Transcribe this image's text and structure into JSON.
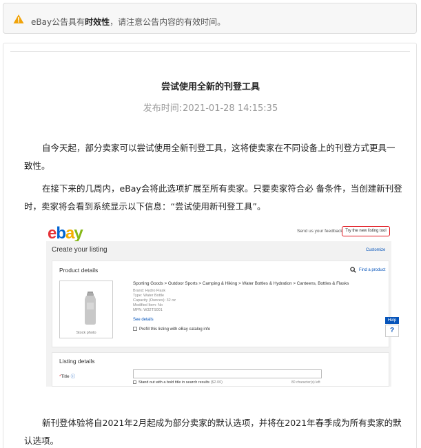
{
  "notice": {
    "prefix": "eBay公告具有",
    "emphasis": "时效性",
    "suffix": "，请注意公告内容的有效时间。"
  },
  "article": {
    "title": "尝试使用全新的刊登工具",
    "publish_label": "发布时间:",
    "publish_time": "2021-01-28 14:15:35",
    "paragraphs": [
      "自今天起，部分卖家可以尝试使用全新刊登工具，这将使卖家在不同设备上的刊登方式更具一致性。",
      "在接下来的几周内，eBay会将此选项扩展至所有卖家。只要卖家符合必 备条件，当创建新刊登时，卖家将会看到系统显示以下信息：“尝试使用新刊登工具”。",
      "新刊登体验将自2021年2月起成为部分卖家的默认选项，并将在2021年春季成为所有卖家的默认选项。"
    ]
  },
  "screenshot": {
    "logo": {
      "e": "e",
      "b": "b",
      "a": "a",
      "y": "y"
    },
    "feedback_link": "Send us your feedback",
    "try_new_tool": "Try the new listing tool",
    "create_title": "Create your listing",
    "customize": "Customize",
    "product_details_title": "Product details",
    "find_product": "Find a product",
    "stock_photo": "Stock photo",
    "categories": "Sporting Goods > Outdoor Sports > Camping & Hiking > Water Bottles & Hydration > Canteens, Bottles & Flasks",
    "meta": {
      "brand": "Brand: Hydro Flask",
      "type": "Type: Water Bottle",
      "capacity": "Capacity (Ounces): 32 oz",
      "modified": "Modified Item: No",
      "mpn": "MPN: W32TS001"
    },
    "see_details": "See details",
    "prefill": "Prefill this listing with eBay catalog info",
    "help": "Help",
    "help_q": "?",
    "listing_details_title": "Listing details",
    "title_label": "Title",
    "title_required": "*",
    "title_info": "ⓘ",
    "standout": "Stand out with a bold title in search results",
    "standout_price": "($2.00)",
    "chars_left": "80 character(s) left"
  },
  "colors": {
    "ebay_red": "#e53238",
    "ebay_blue": "#0064d2",
    "ebay_yellow": "#f5af02",
    "ebay_green": "#86b817",
    "highlight": "#e0131b",
    "warning": "#f0a30a"
  },
  "icons": {
    "notice": "warning-icon",
    "find_product": "search-icon"
  }
}
